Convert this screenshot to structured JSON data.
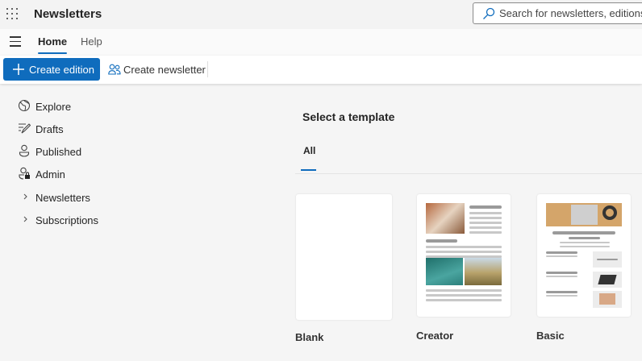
{
  "app": {
    "title": "Newsletters",
    "search_placeholder": "Search for newsletters, editions, o"
  },
  "nav": {
    "tabs": [
      {
        "label": "Home",
        "active": true
      },
      {
        "label": "Help",
        "active": false
      }
    ]
  },
  "toolbar": {
    "create_edition": "Create edition",
    "create_newsletter": "Create newsletter"
  },
  "sidebar": {
    "items": [
      {
        "label": "Explore",
        "icon": "globe-icon"
      },
      {
        "label": "Drafts",
        "icon": "pen-icon"
      },
      {
        "label": "Published",
        "icon": "person-icon"
      },
      {
        "label": "Admin",
        "icon": "person-lock-icon"
      },
      {
        "label": "Newsletters",
        "icon": "chevron-right-icon"
      },
      {
        "label": "Subscriptions",
        "icon": "chevron-right-icon"
      }
    ]
  },
  "main": {
    "heading": "Select a template",
    "filter_tab": "All",
    "templates": [
      {
        "label": "Blank"
      },
      {
        "label": "Creator"
      },
      {
        "label": "Basic"
      }
    ]
  },
  "colors": {
    "accent": "#0f6cbd"
  }
}
